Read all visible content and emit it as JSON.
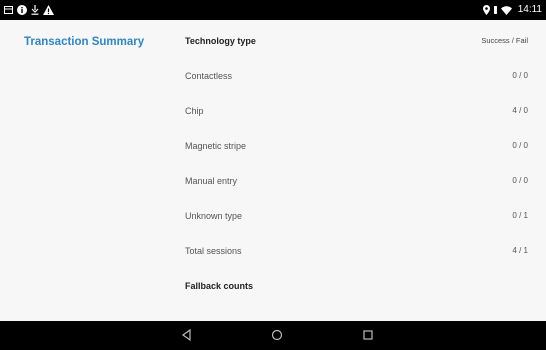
{
  "status_bar": {
    "time": "14:11",
    "left_icons": [
      "message-icon",
      "info-icon",
      "download-icon",
      "warning-icon"
    ],
    "right_icons": [
      "location-icon",
      "vibrate-icon",
      "wifi-icon"
    ]
  },
  "sidebar": {
    "title": "Transaction Summary"
  },
  "table": {
    "header": {
      "label": "Technology type",
      "value": "Success / Fail"
    },
    "rows": [
      {
        "label": "Contactless",
        "value": "0 / 0"
      },
      {
        "label": "Chip",
        "value": "4 / 0"
      },
      {
        "label": "Magnetic stripe",
        "value": "0 / 0"
      },
      {
        "label": "Manual entry",
        "value": "0 / 0"
      },
      {
        "label": "Unknown type",
        "value": "0 / 1"
      },
      {
        "label": "Total sessions",
        "value": "4 / 1"
      }
    ],
    "section": {
      "label": "Fallback counts"
    }
  },
  "nav_bar": {
    "buttons": [
      "back-icon",
      "home-icon",
      "recents-icon"
    ]
  },
  "colors": {
    "accent": "#2f86c4",
    "background": "#f7f7f7",
    "bar": "#000000"
  }
}
